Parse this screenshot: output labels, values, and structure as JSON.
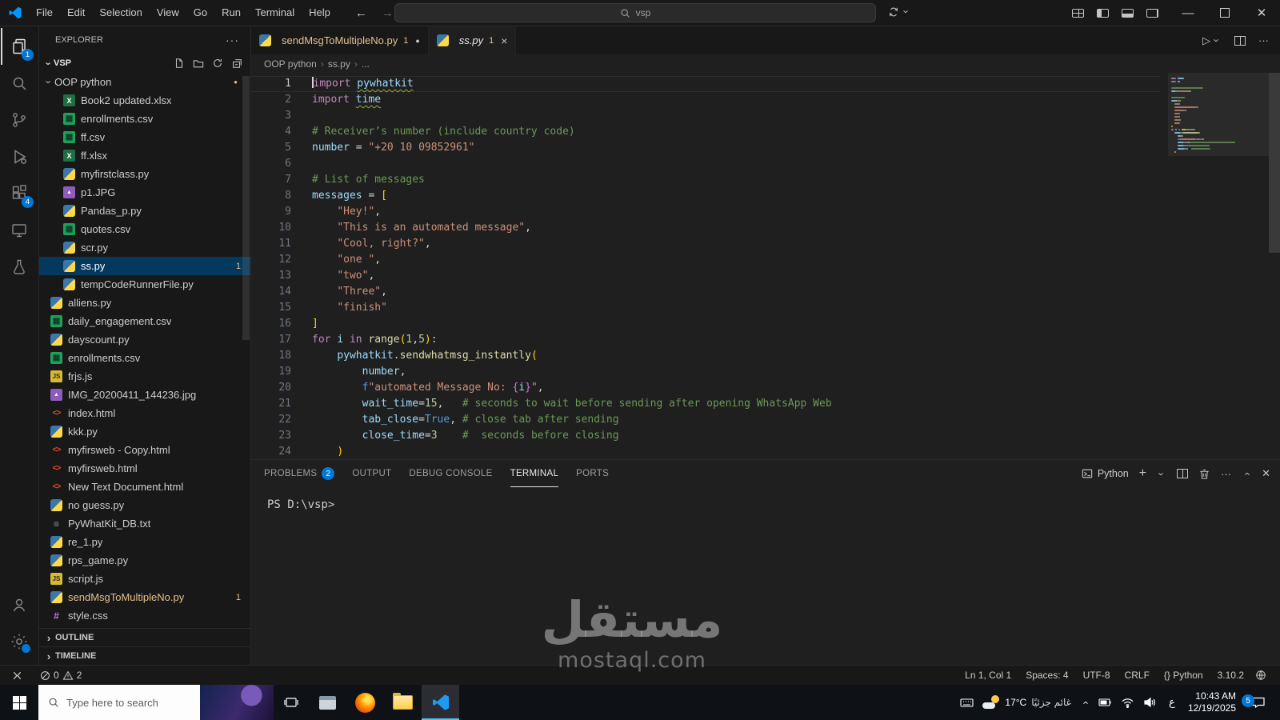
{
  "titlebar": {
    "menus": [
      "File",
      "Edit",
      "Selection",
      "View",
      "Go",
      "Run",
      "Terminal",
      "Help"
    ],
    "search_value": "vsp"
  },
  "activity": {
    "explorer_badge": "1",
    "extensions_badge": "4"
  },
  "sidebar": {
    "title": "EXPLORER",
    "section": "VSP",
    "folder": {
      "name": "OOP python",
      "files": [
        {
          "name": "Book2 updated.xlsx",
          "icon": "excel-icon"
        },
        {
          "name": "enrollments.csv",
          "icon": "csv-icon"
        },
        {
          "name": "ff.csv",
          "icon": "csv-icon"
        },
        {
          "name": "ff.xlsx",
          "icon": "excel-icon"
        },
        {
          "name": "myfirstclass.py",
          "icon": "python-icon"
        },
        {
          "name": "p1.JPG",
          "icon": "image-icon"
        },
        {
          "name": "Pandas_p.py",
          "icon": "python-icon"
        },
        {
          "name": "quotes.csv",
          "icon": "csv-icon"
        },
        {
          "name": "scr.py",
          "icon": "python-icon",
          "selectedx": false
        },
        {
          "name": "ss.py",
          "icon": "python-icon",
          "selected": true,
          "badge": "1"
        },
        {
          "name": "tempCodeRunnerFile.py",
          "icon": "python-icon"
        }
      ]
    },
    "root_files": [
      {
        "name": "alliens.py",
        "icon": "python-icon"
      },
      {
        "name": "daily_engagement.csv",
        "icon": "csv-icon"
      },
      {
        "name": "dayscount.py",
        "icon": "python-icon"
      },
      {
        "name": "enrollments.csv",
        "icon": "csv-icon"
      },
      {
        "name": "frjs.js",
        "icon": "js-icon"
      },
      {
        "name": "IMG_20200411_144236.jpg",
        "icon": "image-icon"
      },
      {
        "name": "index.html",
        "icon": "html-icon"
      },
      {
        "name": "kkk.py",
        "icon": "python-icon"
      },
      {
        "name": "myfirsweb - Copy.html",
        "icon": "html-icon"
      },
      {
        "name": "myfirsweb.html",
        "icon": "html-icon"
      },
      {
        "name": "New Text Document.html",
        "icon": "html-icon"
      },
      {
        "name": "no guess.py",
        "icon": "python-icon"
      },
      {
        "name": "PyWhatKit_DB.txt",
        "icon": "txt-icon"
      },
      {
        "name": "re_1.py",
        "icon": "python-icon"
      },
      {
        "name": "rps_game.py",
        "icon": "python-icon"
      },
      {
        "name": "script.js",
        "icon": "js-icon"
      },
      {
        "name": "sendMsgToMultipleNo.py",
        "icon": "python-icon",
        "modified": true,
        "badge": "1"
      },
      {
        "name": "style.css",
        "icon": "css-icon"
      }
    ],
    "outline_label": "OUTLINE",
    "timeline_label": "TIMELINE"
  },
  "tabs": [
    {
      "label": "sendMsgToMultipleNo.py",
      "icon": "python-icon",
      "badge": "1",
      "modified": true
    },
    {
      "label": "ss.py",
      "icon": "python-icon",
      "badge": "1",
      "active": true
    }
  ],
  "breadcrumbs": [
    "OOP python",
    "ss.py",
    "..."
  ],
  "editor": {
    "lines": [
      [
        [
          "k",
          "import"
        ],
        [
          "p",
          " "
        ],
        [
          "v w",
          "pywhatkit"
        ]
      ],
      [
        [
          "k",
          "import"
        ],
        [
          "p",
          " "
        ],
        [
          "v w",
          "time"
        ]
      ],
      [],
      [
        [
          "c",
          "# Receiver’s number (include country code)"
        ]
      ],
      [
        [
          "v",
          "number"
        ],
        [
          "p",
          " = "
        ],
        [
          "s",
          "\"+20 10 09852961\""
        ]
      ],
      [],
      [
        [
          "c",
          "# List of messages"
        ]
      ],
      [
        [
          "v",
          "messages"
        ],
        [
          "p",
          " = "
        ],
        [
          "g",
          "["
        ]
      ],
      [
        [
          "p",
          "    "
        ],
        [
          "s",
          "\"Hey!\""
        ],
        [
          "p",
          ","
        ]
      ],
      [
        [
          "p",
          "    "
        ],
        [
          "s",
          "\"This is an automated message\""
        ],
        [
          "p",
          ","
        ]
      ],
      [
        [
          "p",
          "    "
        ],
        [
          "s",
          "\"Cool, right?\""
        ],
        [
          "p",
          ","
        ]
      ],
      [
        [
          "p",
          "    "
        ],
        [
          "s",
          "\"one \""
        ],
        [
          "p",
          ","
        ]
      ],
      [
        [
          "p",
          "    "
        ],
        [
          "s",
          "\"two\""
        ],
        [
          "p",
          ","
        ]
      ],
      [
        [
          "p",
          "    "
        ],
        [
          "s",
          "\"Three\""
        ],
        [
          "p",
          ","
        ]
      ],
      [
        [
          "p",
          "    "
        ],
        [
          "s",
          "\"finish\""
        ]
      ],
      [
        [
          "g",
          "]"
        ]
      ],
      [
        [
          "k",
          "for"
        ],
        [
          "p",
          " "
        ],
        [
          "v",
          "i"
        ],
        [
          "p",
          " "
        ],
        [
          "k",
          "in"
        ],
        [
          "p",
          " "
        ],
        [
          "f",
          "range"
        ],
        [
          "g",
          "("
        ],
        [
          "n",
          "1"
        ],
        [
          "p",
          ","
        ],
        [
          "n",
          "5"
        ],
        [
          "g",
          ")"
        ],
        [
          "p",
          ":"
        ]
      ],
      [
        [
          "p",
          "    "
        ],
        [
          "v",
          "pywhatkit"
        ],
        [
          "p",
          "."
        ],
        [
          "f",
          "sendwhatmsg_instantly"
        ],
        [
          "g",
          "("
        ]
      ],
      [
        [
          "p",
          "        "
        ],
        [
          "v",
          "number"
        ],
        [
          "p",
          ","
        ]
      ],
      [
        [
          "p",
          "        "
        ],
        [
          "b",
          "f"
        ],
        [
          "s",
          "\"automated Message No: "
        ],
        [
          "m",
          "{"
        ],
        [
          "v",
          "i"
        ],
        [
          "m",
          "}"
        ],
        [
          "s",
          "\""
        ],
        [
          "p",
          ","
        ]
      ],
      [
        [
          "p",
          "        "
        ],
        [
          "v",
          "wait_time"
        ],
        [
          "p",
          "="
        ],
        [
          "n",
          "15"
        ],
        [
          "p",
          ",   "
        ],
        [
          "c",
          "# seconds to wait before sending after opening WhatsApp Web"
        ]
      ],
      [
        [
          "p",
          "        "
        ],
        [
          "v",
          "tab_close"
        ],
        [
          "p",
          "="
        ],
        [
          "b",
          "True"
        ],
        [
          "p",
          ", "
        ],
        [
          "c",
          "# close tab after sending"
        ]
      ],
      [
        [
          "p",
          "        "
        ],
        [
          "v",
          "close_time"
        ],
        [
          "p",
          "="
        ],
        [
          "n",
          "3"
        ],
        [
          "p",
          "    "
        ],
        [
          "c",
          "#  seconds before closing"
        ]
      ],
      [
        [
          "p",
          "    "
        ],
        [
          "g",
          ")"
        ]
      ]
    ]
  },
  "panel": {
    "tabs": [
      {
        "label": "PROBLEMS",
        "badge": "2"
      },
      {
        "label": "OUTPUT"
      },
      {
        "label": "DEBUG CONSOLE"
      },
      {
        "label": "TERMINAL",
        "active": true
      },
      {
        "label": "PORTS"
      }
    ],
    "terminal_profile": "Python",
    "prompt": "PS D:\\vsp>"
  },
  "status": {
    "errors": "0",
    "warnings": "2",
    "right": [
      "Ln 1, Col 1",
      "Spaces: 4",
      "UTF-8",
      "CRLF",
      "{} Python",
      "3.10.2"
    ]
  },
  "taskbar": {
    "search_placeholder": "Type here to search",
    "weather_temp": "17°C",
    "weather_cond": "غائم جزئيًا",
    "lang": "ع",
    "time": "10:43 AM",
    "date": "12/19/2025",
    "notification_badge": "5"
  },
  "watermark": {
    "title": "مستقل",
    "subtitle": "mostaql.com"
  }
}
